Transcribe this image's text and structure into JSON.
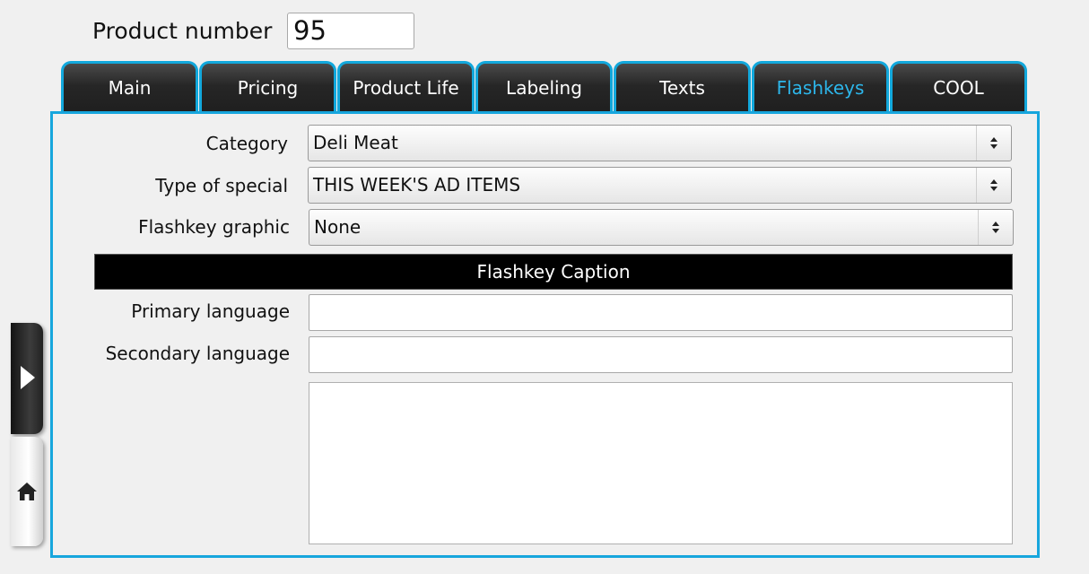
{
  "product": {
    "label": "Product number",
    "value": "95"
  },
  "tabs": [
    {
      "label": "Main",
      "active": false
    },
    {
      "label": "Pricing",
      "active": false
    },
    {
      "label": "Product Life",
      "active": false
    },
    {
      "label": "Labeling",
      "active": false
    },
    {
      "label": "Texts",
      "active": false
    },
    {
      "label": "Flashkeys",
      "active": true
    },
    {
      "label": "COOL",
      "active": false
    }
  ],
  "form": {
    "category": {
      "label": "Category",
      "value": "Deli Meat"
    },
    "special": {
      "label": "Type of special",
      "value": "THIS WEEK'S AD ITEMS"
    },
    "graphic": {
      "label": "Flashkey graphic",
      "value": "None"
    },
    "caption_header": "Flashkey Caption",
    "primary": {
      "label": "Primary language",
      "value": ""
    },
    "secondary": {
      "label": "Secondary language",
      "value": ""
    },
    "notes": {
      "value": ""
    }
  },
  "side": {
    "expand_icon": "play-arrow-icon",
    "home_icon": "home-icon"
  },
  "colors": {
    "accent": "#17a6dd",
    "active_tab_text": "#2db6ea",
    "tab_background": "#262626",
    "background": "#f0f0f0"
  }
}
